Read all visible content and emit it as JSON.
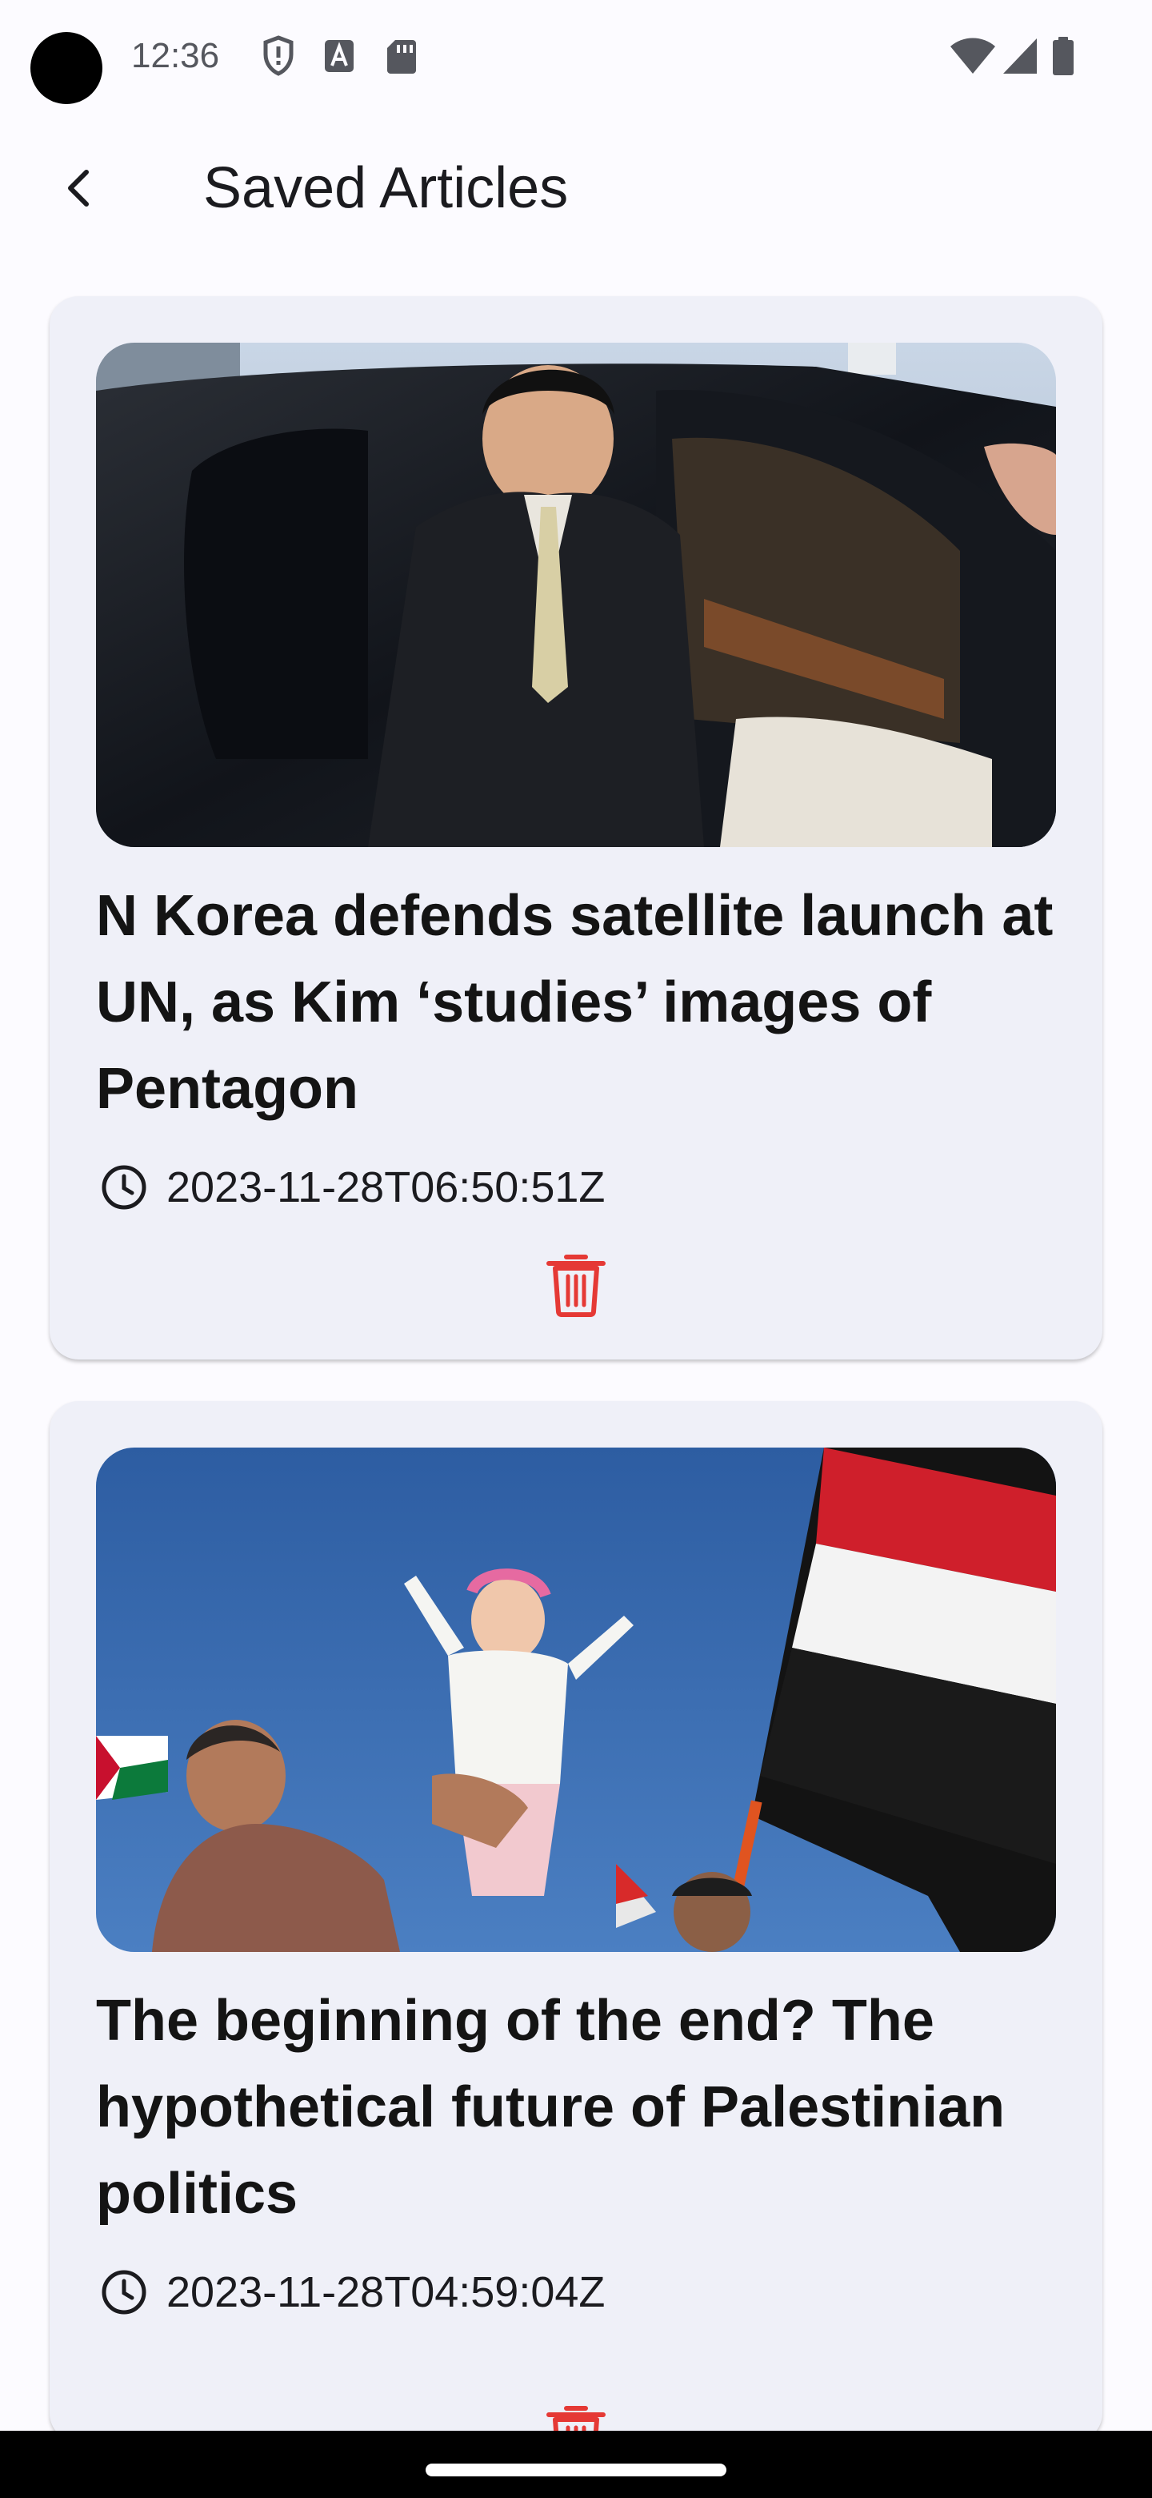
{
  "status_bar": {
    "time": "12:36",
    "icons_left": [
      "shield-icon",
      "text-a-icon",
      "sd-card-icon"
    ],
    "icons_right": [
      "wifi-icon",
      "signal-icon",
      "battery-icon"
    ]
  },
  "app_bar": {
    "title": "Saved Articles",
    "back_icon": "arrow-back-icon"
  },
  "articles": [
    {
      "title": "N Korea defends satellite launch at UN, as Kim ‘studies’ images of Pentagon",
      "date": "2023-11-28T06:50:51Z",
      "image": "photo of a man in a dark suit stepping out of a black car"
    },
    {
      "title": "The beginning of the end? The hypothetical future of Palestinian politics",
      "date": "2023-11-28T04:59:04Z",
      "image": "photo of a man lifting a child with flags against blue sky"
    }
  ],
  "colors": {
    "background": "#fcfbff",
    "card": "#eff0f8",
    "delete": "#e53935",
    "title_text": "#141414"
  }
}
